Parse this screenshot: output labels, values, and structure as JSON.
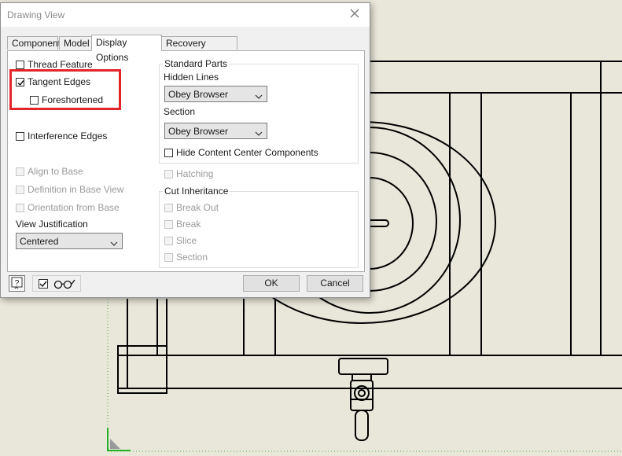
{
  "dialog": {
    "title": "Drawing View",
    "tabs": [
      {
        "label": "Component"
      },
      {
        "label": "Model"
      },
      {
        "label": "Display Options"
      },
      {
        "label": "Recovery Options"
      }
    ],
    "left": {
      "thread_feature": "Thread Feature",
      "tangent_edges": "Tangent Edges",
      "foreshortened": "Foreshortened",
      "interference_edges": "Interference Edges",
      "align_to_base": "Align to Base",
      "definition_in_base_view": "Definition in Base View",
      "orientation_from_base": "Orientation from Base",
      "view_justification_label": "View Justification",
      "view_justification_value": "Centered"
    },
    "right": {
      "standard_parts": "Standard Parts",
      "hidden_lines_label": "Hidden Lines",
      "hidden_lines_value": "Obey Browser",
      "section_label": "Section",
      "section_value": "Obey Browser",
      "hide_cc": "Hide Content Center Components",
      "hatching": "Hatching",
      "cut_inheritance": "Cut Inheritance",
      "break_out": "Break Out",
      "break": "Break",
      "slice": "Slice",
      "section": "Section"
    },
    "buttons": {
      "ok": "OK",
      "cancel": "Cancel"
    }
  },
  "colors": {
    "highlight": "#e3242b",
    "sheet": "#e9e7d9",
    "border_dots": "#3fae3f"
  }
}
